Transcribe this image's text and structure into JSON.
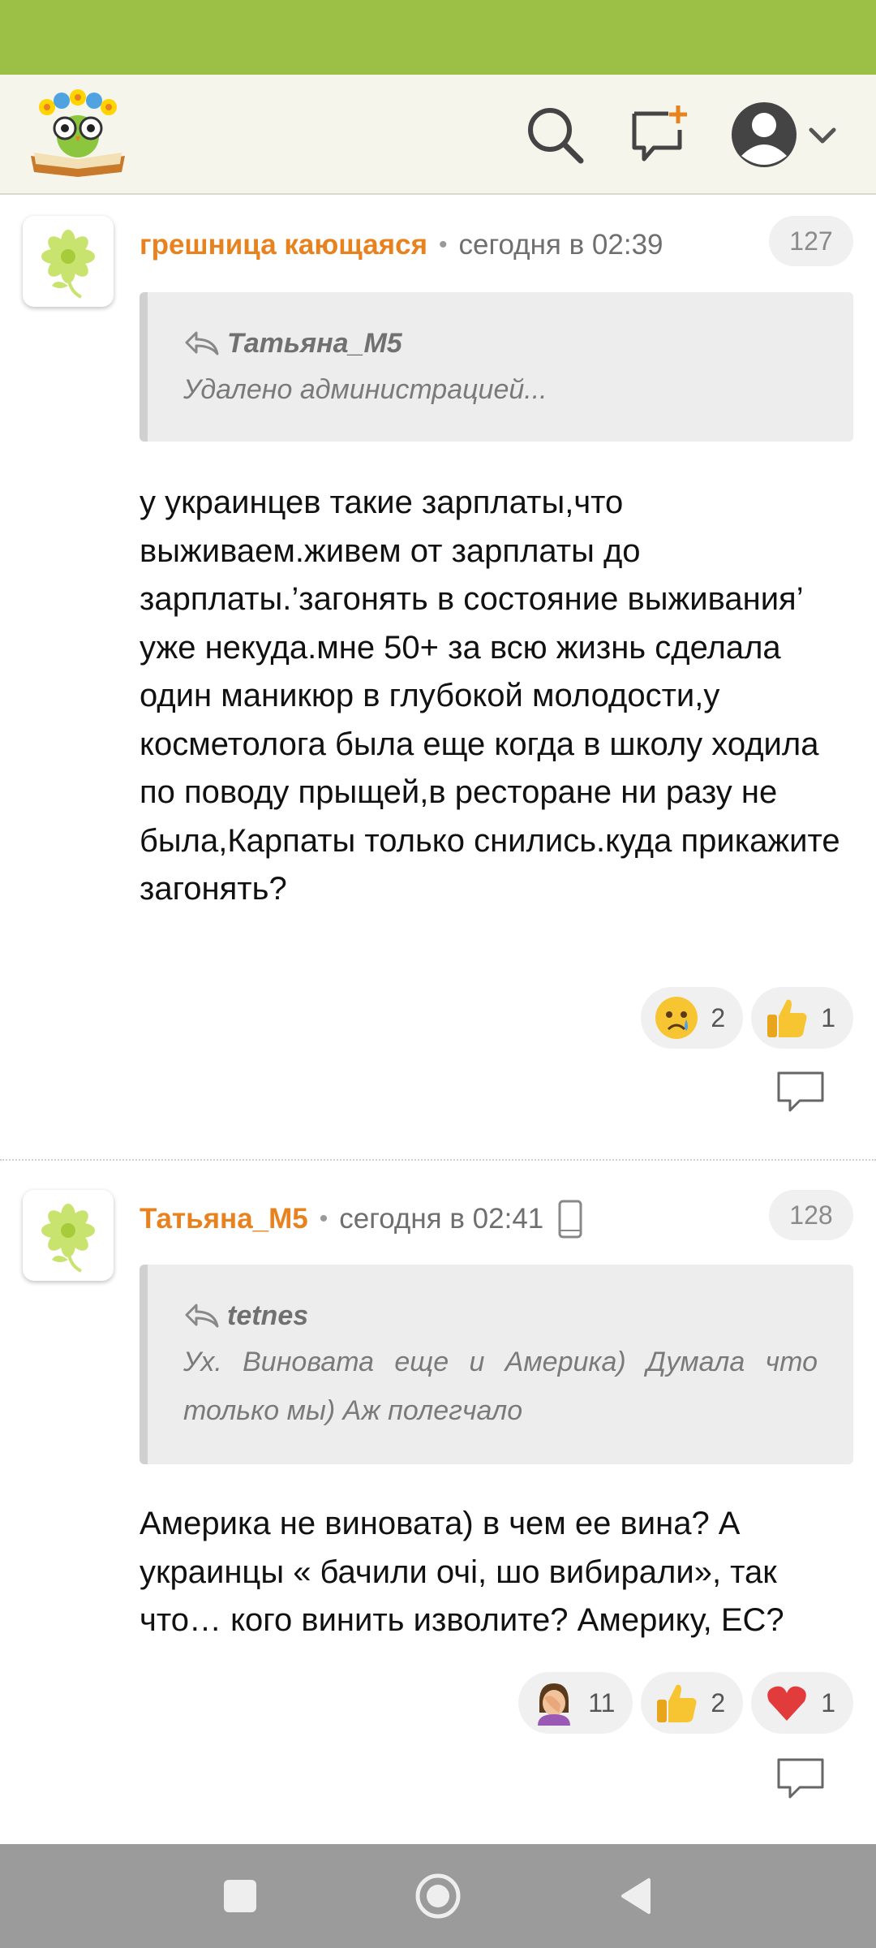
{
  "colors": {
    "accent": "#9cc045",
    "author": "#e8821e",
    "header_bg": "#f5f5ec"
  },
  "header": {
    "logo_icon": "owl-book-logo-icon",
    "search_icon": "search-icon",
    "new_topic_icon": "new-topic-icon",
    "profile_icon": "profile-avatar-icon",
    "dropdown_icon": "chevron-down-icon"
  },
  "comments": [
    {
      "author": "грешница кающаяся",
      "time": "сегодня в 02:39",
      "number": "127",
      "quote": {
        "author": "Татьяна_М5",
        "text": "Удалено администрацией..."
      },
      "text": "у украинцев такие зарплаты,что выживаем.живем от зарплаты до зарплаты.’загонять в состояние выживания’ уже некуда.мне 50+ за всю жизнь сделала один маникюр в глубокой молодости,у косметолога была еще когда в школу ходила по поводу прыщей,в ресторане ни разу не была,Карпаты только снились.куда прикажите загонять?",
      "reactions": [
        {
          "emoji": "crying-face-icon",
          "count": "2"
        },
        {
          "emoji": "thumbs-up-icon",
          "count": "1"
        }
      ]
    },
    {
      "author": "Татьяна_М5",
      "time": "сегодня в 02:41",
      "number": "128",
      "quote": {
        "author": "tetnes",
        "text": "Ух. Виновата еще и Америка) Думала что только мы) Аж полегчало"
      },
      "text": "Америка не виновата) в чем ее вина? А украинцы « бачили очі, шо вибирали», так что… кого винить изволите? Америку, ЕС?",
      "reactions": [
        {
          "emoji": "facepalm-icon",
          "count": "11"
        },
        {
          "emoji": "thumbs-up-icon",
          "count": "2"
        },
        {
          "emoji": "heart-icon",
          "count": "1"
        }
      ]
    }
  ],
  "navbar": {
    "recents_icon": "square-icon",
    "home_icon": "circle-icon",
    "back_icon": "triangle-back-icon"
  }
}
